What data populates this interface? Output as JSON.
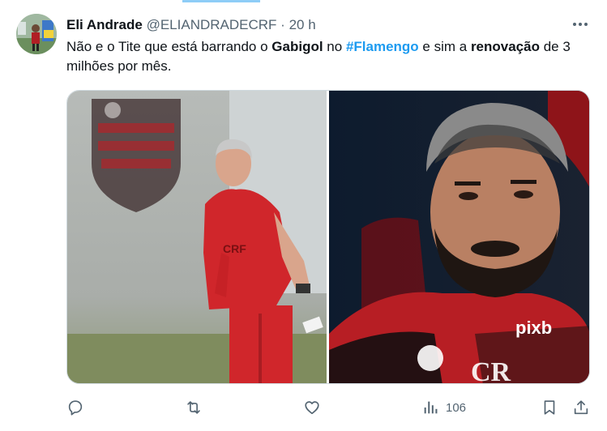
{
  "author": {
    "name": "Eli Andrade",
    "handle": "@ELIANDRADECRF",
    "separator": "·",
    "time": "20 h"
  },
  "tweet": {
    "seg1": "Não e o Tite que está barrando o ",
    "bold1": "Gabigol",
    "seg2": " no ",
    "hashtag": "#Flamengo",
    "seg3": " e sim a ",
    "bold2": "renovação",
    "seg4": " de 3 milhões por mês."
  },
  "media": {
    "left_icon": "coach-photo",
    "right_icon": "player-photo"
  },
  "actions": {
    "reply_icon": "reply-icon",
    "retweet_icon": "retweet-icon",
    "like_icon": "like-icon",
    "views_icon": "views-icon",
    "views_count": "106",
    "bookmark_icon": "bookmark-icon",
    "share_icon": "share-icon"
  },
  "colors": {
    "accent": "#1d9bf0",
    "secondary_text": "#536471",
    "primary_text": "#0f1419"
  }
}
